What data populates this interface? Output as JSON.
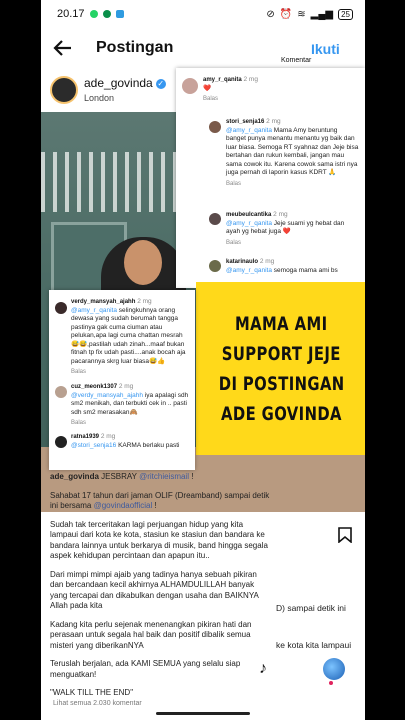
{
  "status": {
    "time": "20.17",
    "battery": "25"
  },
  "topbar": {
    "title": "Postingan",
    "follow_label": "Ikuti"
  },
  "post": {
    "username": "ade_govinda",
    "location": "London"
  },
  "overlay_text": [
    "MAMA AMI",
    "SUPPORT JEJE",
    "DI POSTINGAN",
    "ADE GOVINDA"
  ],
  "comments_panel": {
    "title": "Komentar",
    "items": [
      {
        "user": "amy_r_qanita",
        "time": "2 mg",
        "text": "❤️",
        "reply": "Balas"
      },
      {
        "user": "stori_senja16",
        "time": "2 mg",
        "mention": "@amy_r_qanita",
        "text": " Mama Amy beruntung banget punya menantu menantu yg baik dan luar biasa. Semoga RT syahnaz dan Jeje bisa bertahan dan rukun kembali, jangan mau sama cowok itu. Karena cowok sama istri nya juga pernah di laporin kasus KDRT 🙏",
        "reply": "Balas"
      },
      {
        "user": "meubeulcantika",
        "time": "2 mg",
        "mention": "@amy_r_qanita",
        "text": " Jeje suami yg hebat dan ayah yg hebat juga ❤️",
        "reply": "Balas"
      },
      {
        "user": "katarinaulo",
        "time": "2 mg",
        "mention": "@amy_r_qanita",
        "text": " semoga mama ami bs",
        "reply": ""
      }
    ]
  },
  "left_panel": {
    "items": [
      {
        "user": "verdy_mansyah_ajahh",
        "time": "2 mg",
        "mention": "@amy_r_qanita",
        "text": " selingkuhnya orang dewasa yang sudah berumah tangga pastinya gak cuma ciuman atau pelukan,apa lagi cuma chattan mesrah 😅😅,pastilah udah zinah...maaf bukan fitnah tp fix udah pasti....anak bocah aja pacarannya skrg luar biasa😅👍",
        "reply": "Balas"
      },
      {
        "user": "cuz_meonk1307",
        "time": "2 mg",
        "mention": "@verdy_mansyah_ajahh",
        "text": " iya apalagi sdh sm2 menikah, dan terbukti cek in .. pasti sdh sm2 merasakan🙈",
        "reply": "Balas"
      },
      {
        "user": "ratna1939",
        "time": "2 mg",
        "mention": "@stori_senja16",
        "text": " KARMA berlaku pasti",
        "reply": ""
      }
    ]
  },
  "caption": {
    "first_user": "ade_govinda",
    "first_text": " JESBRAY ",
    "first_mention": "@ritchieismail",
    "first_tail": " !",
    "p1": "Sahabat 17 tahun dari jaman OLIF (Dreamband) sampai detik ini bersama ",
    "p1_mention": "@govindaofficial",
    "p1_tail": " !",
    "p2": "Sudah tak terceritakan lagi perjuangan hidup yang kita lampaui dari kota ke kota, stasiun ke stasiun dan bandara ke bandara lainnya untuk berkarya di musik, band hingga segala aspek kehidupan percintaan dan apapun itu..",
    "p3": "Dari mimpi mimpi ajaib yang tadinya hanya sebuah pikiran dan bercandaan kecil akhirnya ALHAMDULILLAH banyak yang tercapai dan dikabulkan dengan usaha dan BAIKNYA Allah pada kita",
    "p4": "Kadang kita perlu sejenak menenangkan pikiran hati dan perasaan untuk segala hal baik dan positif dibalik semua misteri yang diberikanNYA",
    "p5": "Teruslah berjalan, ada KAMI SEMUA yang selalu siap menguatkan!",
    "p6": "\"WALK TILL THE END\"",
    "view_all": "Lihat semua 2.030 komentar"
  },
  "right_text": {
    "line1": "D) sampai detik ini",
    "line2": "ke kota kita lampaui"
  },
  "colors": {
    "accent": "#3797f0",
    "overlay_yellow": "#ffd91a"
  }
}
